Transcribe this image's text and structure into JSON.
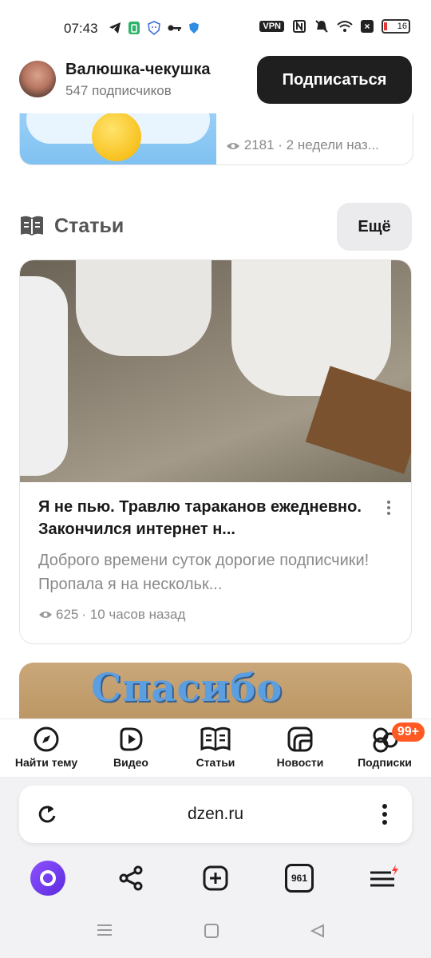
{
  "status_bar": {
    "time": "07:43",
    "vpn_label": "VPN",
    "battery": "16",
    "left_icons": [
      "telegram-icon",
      "battery-saver-icon",
      "shield-face-icon",
      "key-icon",
      "security-shield-icon"
    ],
    "right_icons": [
      "vpn-badge",
      "nfc-icon",
      "mute-icon",
      "wifi-icon",
      "x-box-icon",
      "battery-icon"
    ]
  },
  "channel": {
    "name": "Валюшка-чекушка",
    "subscribers": "547 подписчиков",
    "subscribe_label": "Подписаться"
  },
  "top_card": {
    "views": "2181",
    "time": " · 2 недели наз..."
  },
  "section": {
    "title": "Статьи",
    "more_label": "Ещё"
  },
  "article": {
    "title": "Я не пью. Травлю тараканов ежедневно. Закончился интернет н...",
    "description": "Доброго времени суток дорогие подписчики! Пропала я на нескольк...",
    "views": "625",
    "time": " · 10 часов назад"
  },
  "next_card": {
    "image_text": "Спасибо"
  },
  "tabs": [
    {
      "label": "Найти тему",
      "icon": "compass-icon"
    },
    {
      "label": "Видео",
      "icon": "video-play-icon"
    },
    {
      "label": "Статьи",
      "icon": "articles-icon"
    },
    {
      "label": "Новости",
      "icon": "news-icon"
    },
    {
      "label": "Подписки",
      "icon": "subscriptions-icon"
    }
  ],
  "subscriptions_badge": "99+",
  "browser": {
    "url": "dzen.ru",
    "tabs_count": "961"
  },
  "colors": {
    "accent_orange": "#ff5a24",
    "alice_purple": "#7a3ff2",
    "dark_button": "#1f1f1f"
  }
}
